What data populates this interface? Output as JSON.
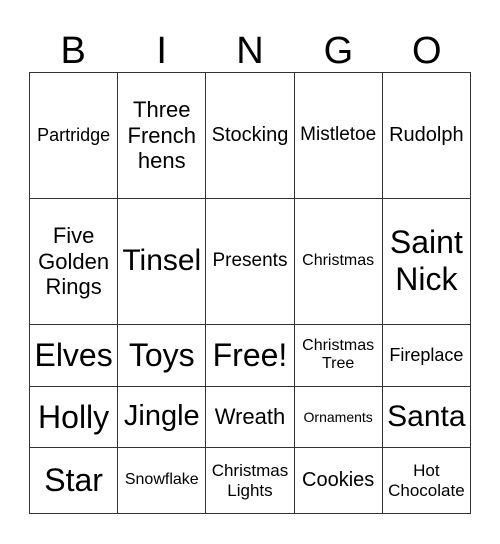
{
  "header": [
    "B",
    "I",
    "N",
    "G",
    "O"
  ],
  "rows": [
    [
      "Partridge",
      "Three French hens",
      "Stocking",
      "Mistletoe",
      "Rudolph"
    ],
    [
      "Five Golden Rings",
      "Tinsel",
      "Presents",
      "Christmas",
      "Saint Nick"
    ],
    [
      "Elves",
      "Toys",
      "Free!",
      "Christmas Tree",
      "Fireplace"
    ],
    [
      "Holly",
      "Jingle",
      "Wreath",
      "Ornaments",
      "Santa"
    ],
    [
      "Star",
      "Snowflake",
      "Christmas Lights",
      "Cookies",
      "Hot Chocolate"
    ]
  ]
}
